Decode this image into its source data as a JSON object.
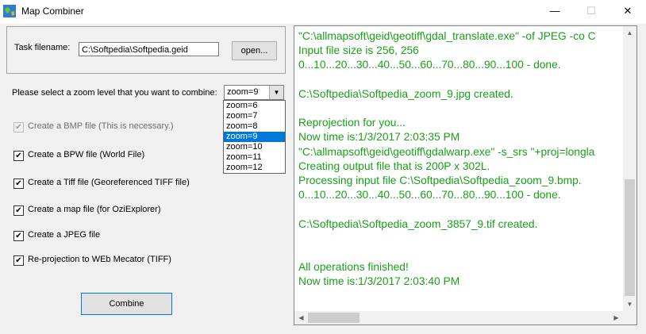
{
  "window": {
    "title": "Map Combiner",
    "icon": "map-globe-icon",
    "minimize_glyph": "—",
    "maximize_glyph": "☐",
    "close_glyph": "✕"
  },
  "task": {
    "label": "Task filename:",
    "value": "C:\\Softpedia\\Softpedia.geid",
    "open_button": "open..."
  },
  "zoom": {
    "label": "Please select a zoom level that you want to combine:",
    "selected": "zoom=9",
    "options": [
      "zoom=6",
      "zoom=7",
      "zoom=8",
      "zoom=9",
      "zoom=10",
      "zoom=11",
      "zoom=12"
    ],
    "selected_index": 3
  },
  "checkboxes": [
    {
      "label": "Create a BMP file (This is necessary.)",
      "checked": true,
      "disabled": true
    },
    {
      "label": "Create a BPW file (World File)",
      "checked": true,
      "disabled": false
    },
    {
      "label": "Create a Tiff file (Georeferenced TIFF file)",
      "checked": true,
      "disabled": false
    },
    {
      "label": "Create a map file (for OziExplorer)",
      "checked": true,
      "disabled": false
    },
    {
      "label": "Create a JPEG file",
      "checked": true,
      "disabled": false
    },
    {
      "label": "Re-projection to WEb Mecator  (TIFF)",
      "checked": true,
      "disabled": false
    }
  ],
  "combine_button": "Combine",
  "log": {
    "lines": [
      "\"C:\\allmapsoft\\geid\\geotiff\\gdal_translate.exe\" -of JPEG -co C",
      "Input file size is 256, 256",
      "0...10...20...30...40...50...60...70...80...90...100 - done.",
      "",
      "C:\\Softpedia\\Softpedia_zoom_9.jpg created.",
      "",
      "Reprojection for you...",
      "Now time is:1/3/2017 2:03:35 PM",
      "\"C:\\allmapsoft\\geid\\geotiff\\gdalwarp.exe\" -s_srs \"+proj=longla",
      "Creating output file that is 200P x 302L.",
      "Processing input file C:\\Softpedia\\Softpedia_zoom_9.bmp.",
      "0...10...20...30...40...50...60...70...80...90...100 - done.",
      "",
      "C:\\Softpedia\\Softpedia_zoom_3857_9.tif created.",
      "",
      "",
      "All operations finished!",
      "Now time is:1/3/2017 2:03:40 PM"
    ],
    "text_color": "#19a019"
  },
  "colors": {
    "selection": "#0078d7",
    "log_text": "#19a019"
  }
}
